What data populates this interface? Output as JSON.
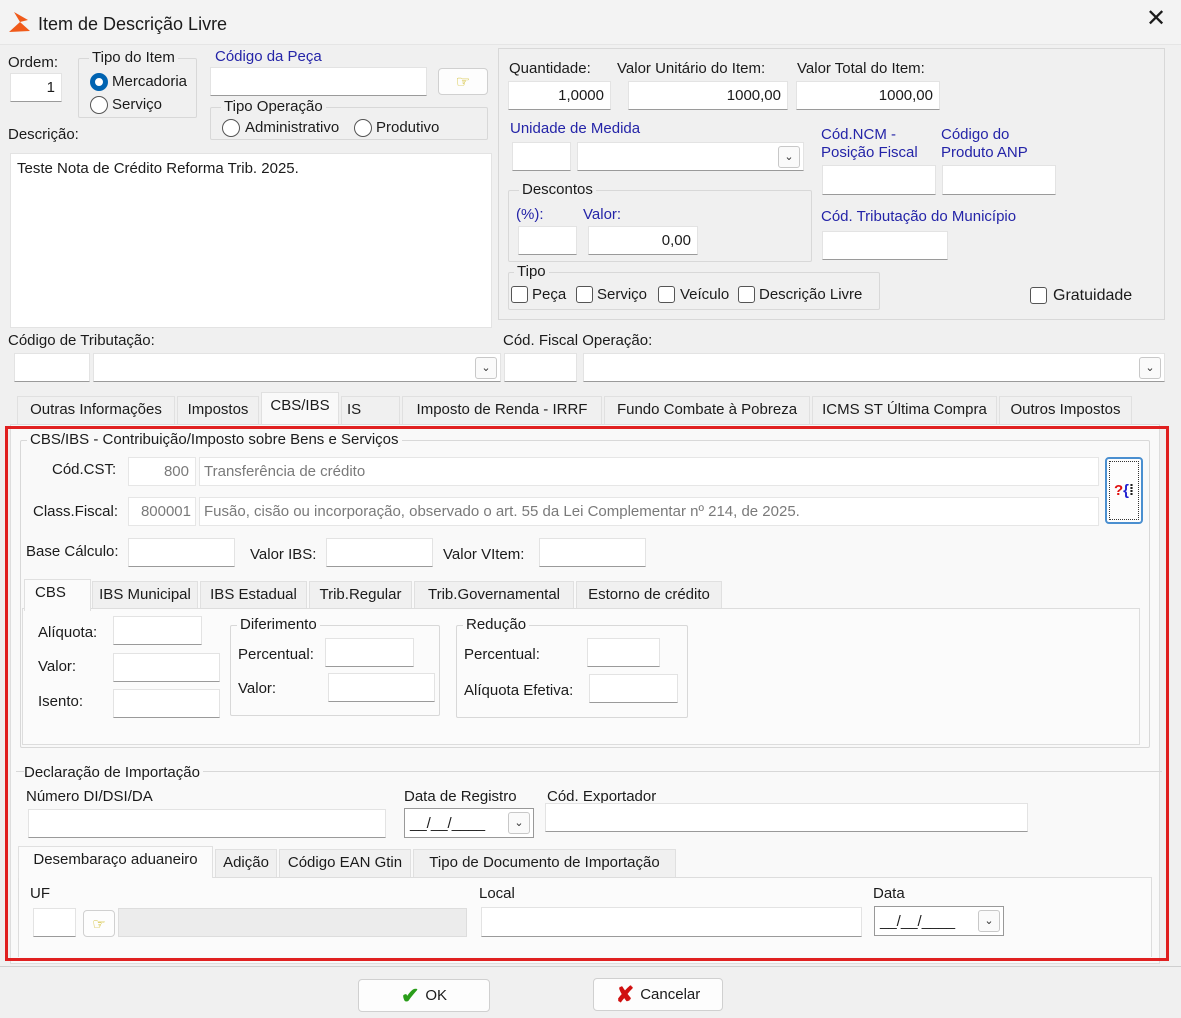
{
  "window": {
    "title": "Item de Descrição Livre"
  },
  "top": {
    "ordem_label": "Ordem:",
    "ordem_value": "1",
    "tipo_item_label": "Tipo do Item",
    "tipo_item_options": [
      "Mercadoria",
      "Serviço"
    ],
    "tipo_item_selected": "Mercadoria",
    "codigo_peca_label": "Código da Peça",
    "codigo_peca_value": "",
    "tipo_operacao_label": "Tipo Operação",
    "tipo_operacao_options": [
      "Administrativo",
      "Produtivo"
    ],
    "descricao_label": "Descrição:",
    "descricao_value": "Teste Nota de Crédito Reforma Trib. 2025."
  },
  "right": {
    "quantidade_label": "Quantidade:",
    "quantidade_value": "1,0000",
    "valor_unitario_label": "Valor Unitário do Item:",
    "valor_unitario_value": "1000,00",
    "valor_total_label": "Valor Total do Item:",
    "valor_total_value": "1000,00",
    "unidade_label": "Unidade de Medida",
    "ncm_label_1": "Cód.NCM -",
    "ncm_label_2": "Posição Fiscal",
    "anp_label_1": "Código do",
    "anp_label_2": "Produto ANP",
    "descontos_label": "Descontos",
    "desc_pct_label": "(%):",
    "desc_valor_label": "Valor:",
    "desc_valor_value": "0,00",
    "cod_trib_mun_label": "Cód. Tributação do Município",
    "tipo_label": "Tipo",
    "tipo_checks": [
      "Peça",
      "Serviço",
      "Veículo",
      "Descrição Livre"
    ],
    "gratuidade_label": "Gratuidade"
  },
  "codigos": {
    "cod_tributacao_label": "Código de Tributação:",
    "cod_fiscal_label": "Cód. Fiscal Operação:"
  },
  "tabs": [
    "Outras Informações",
    "Impostos",
    "CBS/IBS",
    "IS",
    "Imposto de Renda - IRRF",
    "Fundo Combate à Pobreza",
    "ICMS ST Última Compra",
    "Outros Impostos"
  ],
  "cbsibs": {
    "group_label": "CBS/IBS -  Contribuição/Imposto sobre Bens e Serviços",
    "cst_label": "Cód.CST:",
    "cst_code": "800",
    "cst_desc": "Transferência de crédito",
    "class_label": "Class.Fiscal:",
    "class_code": "800001",
    "class_desc": "Fusão, cisão ou incorporação, observado o art. 55 da Lei Complementar nº 214, de 2025.",
    "base_label": "Base Cálculo:",
    "valor_ibs_label": "Valor IBS:",
    "valor_vitem_label": "Valor VItem:",
    "subtabs": [
      "CBS",
      "IBS Municipal",
      "IBS Estadual",
      "Trib.Regular",
      "Trib.Governamental",
      "Estorno de crédito"
    ],
    "aliquota_label": "Alíquota:",
    "valor_label": "Valor:",
    "isento_label": "Isento:",
    "diferimento_label": "Diferimento",
    "dif_percentual_label": "Percentual:",
    "dif_valor_label": "Valor:",
    "reducao_label": "Redução",
    "red_percentual_label": "Percentual:",
    "red_aliq_label": "Alíquota Efetiva:"
  },
  "importacao": {
    "group_label": "Declaração de Importação",
    "numero_label": "Número DI/DSI/DA",
    "data_registro_label": "Data de Registro",
    "data_registro_value": "__/__/____",
    "exportador_label": "Cód. Exportador",
    "subtabs": [
      "Desembaraço aduaneiro",
      "Adição",
      "Código EAN Gtin",
      "Tipo de Documento de Importação"
    ],
    "uf_label": "UF",
    "local_label": "Local",
    "data_label": "Data",
    "data_value": "__/__/____"
  },
  "buttons": {
    "ok": "OK",
    "cancelar": "Cancelar"
  },
  "colors": {
    "highlight": "#e02020",
    "accent": "#0063b1",
    "label_blue": "#2424a8"
  }
}
